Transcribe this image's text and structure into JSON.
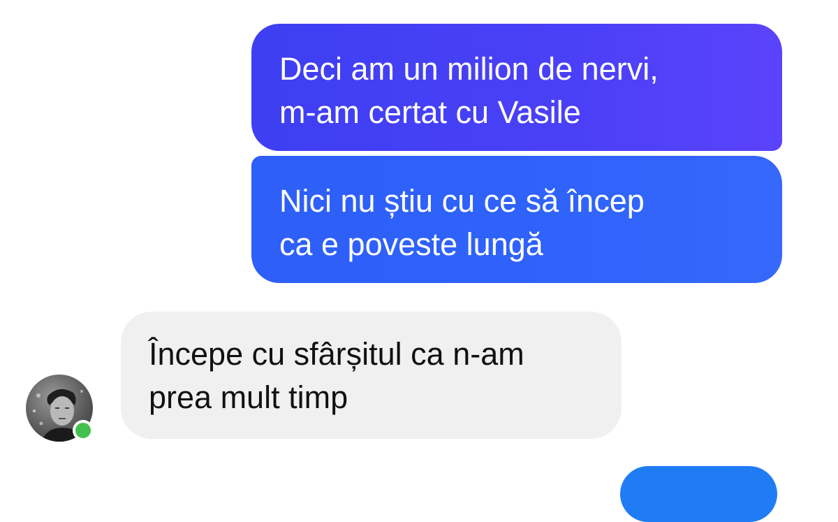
{
  "messages": [
    {
      "direction": "outgoing",
      "text": "Deci am un milion de nervi,\nm-am certat cu Vasile"
    },
    {
      "direction": "outgoing",
      "text": "Nici nu știu cu ce să încep\nca e poveste lungă"
    },
    {
      "direction": "incoming",
      "text": "Începe cu sfârșitul ca n-am\nprea mult timp"
    }
  ],
  "contact": {
    "avatar": "person-photo",
    "online_status_color": "#42c04b"
  },
  "colors": {
    "outgoing_bubble": "#4a40f7",
    "outgoing_bubble_2": "#2f63fa",
    "incoming_bubble": "#f1f0f0",
    "next_outgoing_bubble": "#1f7cf5"
  }
}
